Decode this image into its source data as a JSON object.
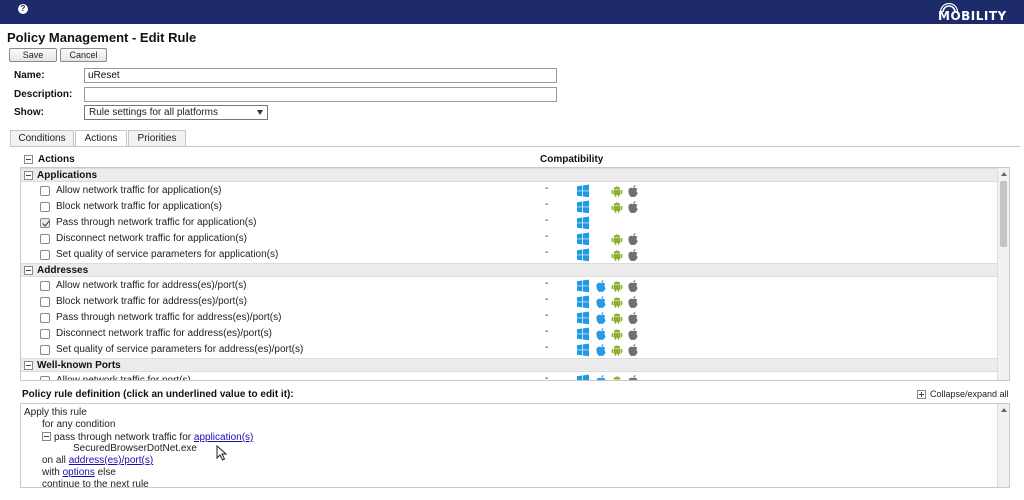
{
  "header": {
    "help_glyph": "?",
    "logo_text": "MOBILITY"
  },
  "page": {
    "title": "Policy Management - Edit Rule"
  },
  "toolbar": {
    "save_label": "Save",
    "cancel_label": "Cancel"
  },
  "form": {
    "name_label": "Name:",
    "name_value": "uReset",
    "description_label": "Description:",
    "description_value": "",
    "show_label": "Show:",
    "show_value": "Rule settings for all platforms"
  },
  "tabs": [
    {
      "label": "Conditions",
      "active": false
    },
    {
      "label": "Actions",
      "active": true
    },
    {
      "label": "Priorities",
      "active": false
    }
  ],
  "actions_panel": {
    "header": "Actions",
    "compat_header": "Compatibility",
    "groups": [
      {
        "name": "Applications",
        "rows": [
          {
            "label": "Allow network traffic for application(s)",
            "checked": false,
            "compat": "-",
            "icons": [
              "windows",
              "android",
              "apple"
            ]
          },
          {
            "label": "Block network traffic for application(s)",
            "checked": false,
            "compat": "-",
            "icons": [
              "windows",
              "android",
              "apple"
            ]
          },
          {
            "label": "Pass through network traffic for application(s)",
            "checked": true,
            "compat": "-",
            "icons": [
              "windows"
            ]
          },
          {
            "label": "Disconnect network traffic for application(s)",
            "checked": false,
            "compat": "-",
            "icons": [
              "windows",
              "android",
              "apple"
            ]
          },
          {
            "label": "Set quality of service parameters for application(s)",
            "checked": false,
            "compat": "-",
            "icons": [
              "windows",
              "android",
              "apple"
            ]
          }
        ]
      },
      {
        "name": "Addresses",
        "rows": [
          {
            "label": "Allow network traffic for address(es)/port(s)",
            "checked": false,
            "compat": "-",
            "icons": [
              "windows",
              "apple-blue",
              "android",
              "apple"
            ]
          },
          {
            "label": "Block network traffic for address(es)/port(s)",
            "checked": false,
            "compat": "-",
            "icons": [
              "windows",
              "apple-blue",
              "android",
              "apple"
            ]
          },
          {
            "label": "Pass through network traffic for address(es)/port(s)",
            "checked": false,
            "compat": "-",
            "icons": [
              "windows",
              "apple-blue",
              "android",
              "apple"
            ]
          },
          {
            "label": "Disconnect network traffic for address(es)/port(s)",
            "checked": false,
            "compat": "-",
            "icons": [
              "windows",
              "apple-blue",
              "android",
              "apple"
            ]
          },
          {
            "label": "Set quality of service parameters for address(es)/port(s)",
            "checked": false,
            "compat": "-",
            "icons": [
              "windows",
              "apple-blue",
              "android",
              "apple"
            ]
          }
        ]
      },
      {
        "name": "Well-known Ports",
        "rows": [
          {
            "label": "Allow network traffic for port(s)",
            "checked": false,
            "compat": "-",
            "icons": [
              "windows",
              "apple-blue",
              "android",
              "apple"
            ]
          }
        ]
      }
    ]
  },
  "definition": {
    "heading": "Policy rule definition (click an underlined value to edit it):",
    "collapse_label": "Collapse/expand all",
    "line1": "Apply this rule",
    "line2": "for any condition",
    "line3_prefix": "pass through network traffic for",
    "line3_link": "application(s)",
    "line4": "SecuredBrowserDotNet.exe",
    "line5_prefix": "on all",
    "line5_link": "address(es)/port(s)",
    "line6_prefix": "with",
    "line6_link": "options",
    "line6_suffix": "else",
    "line7": "continue to the next rule"
  },
  "colors": {
    "header_bg": "#1d2b6b",
    "windows": "#1e9ae0",
    "android": "#8cb032",
    "apple_gray": "#6f6f6f",
    "apple_blue": "#2b9ae6",
    "link": "#1a0dab"
  }
}
